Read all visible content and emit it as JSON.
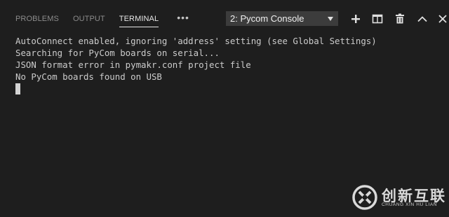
{
  "tabs": [
    {
      "label": "PROBLEMS",
      "active": false
    },
    {
      "label": "OUTPUT",
      "active": false
    },
    {
      "label": "TERMINAL",
      "active": true
    }
  ],
  "more_label": "•••",
  "console_select": {
    "selected": "2: Pycom Console"
  },
  "actions": {
    "add": "plus-icon",
    "split": "split-editor-icon",
    "kill": "trash-icon",
    "maximize": "chevron-up-icon",
    "close": "close-icon"
  },
  "terminal": {
    "lines": [
      "AutoConnect enabled, ignoring 'address' setting (see Global Settings)",
      "Searching for PyCom boards on serial...",
      "JSON format error in pymakr.conf project file",
      "No PyCom boards found on USB"
    ]
  },
  "watermark": {
    "title": "创新互联",
    "subtitle": "CHUANG XIN HU LIAN"
  },
  "colors": {
    "background": "#1e1e1e",
    "text": "#cccccc",
    "active_tab": "#e7e7e7",
    "inactive_tab": "#8b8b8b",
    "select_bg": "#3c3c3c"
  }
}
